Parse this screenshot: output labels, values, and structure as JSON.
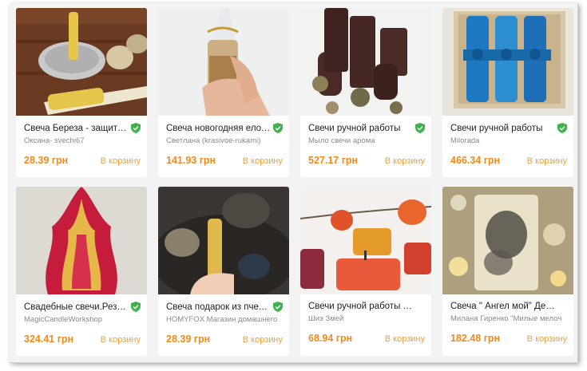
{
  "colors": {
    "price": "#f08a1c",
    "cart": "#f0a040",
    "shield": "#3fb24a"
  },
  "cards": [
    {
      "title": "Свеча Береза - защита, ...",
      "seller": "Оксана- svechi67",
      "price": "28.39 грн",
      "cart_label": "В корзину",
      "icon": "shield-check-icon"
    },
    {
      "title": "Свеча новогодняя елоч...",
      "seller": "Светлана (krasivoe-rukami)",
      "price": "141.93 грн",
      "cart_label": "В корзину",
      "icon": "shield-check-icon"
    },
    {
      "title": "Свечи ручной работы",
      "seller": "Мыло свечи арома",
      "price": "527.17 грн",
      "cart_label": "В корзину",
      "icon": "shield-check-icon"
    },
    {
      "title": "Свечи ручной работы",
      "seller": "Milorada",
      "price": "466.34 грн",
      "cart_label": "В корзину",
      "icon": "shield-check-icon"
    },
    {
      "title": "Свадебные свечи.Резн...",
      "seller": "MagicCandleWorkshop",
      "price": "324.41 грн",
      "cart_label": "В корзину",
      "icon": "shield-check-icon"
    },
    {
      "title": "Свеча подарок из пчели...",
      "seller": "HOMYFOX Магазин домашнего ...",
      "price": "28.39 грн",
      "cart_label": "В корзину",
      "icon": "shield-check-icon"
    },
    {
      "title": "Свечи ручной работы в гил...",
      "seller": "Шиэ Змей",
      "price": "68.94 грн",
      "cart_label": "В корзину",
      "icon": ""
    },
    {
      "title": "Свеча \" Ангел мой\" Декупа...",
      "seller": "Милана Гиренко \"Милые мелочи\"",
      "price": "182.48 грн",
      "cart_label": "В корзину",
      "icon": ""
    }
  ]
}
